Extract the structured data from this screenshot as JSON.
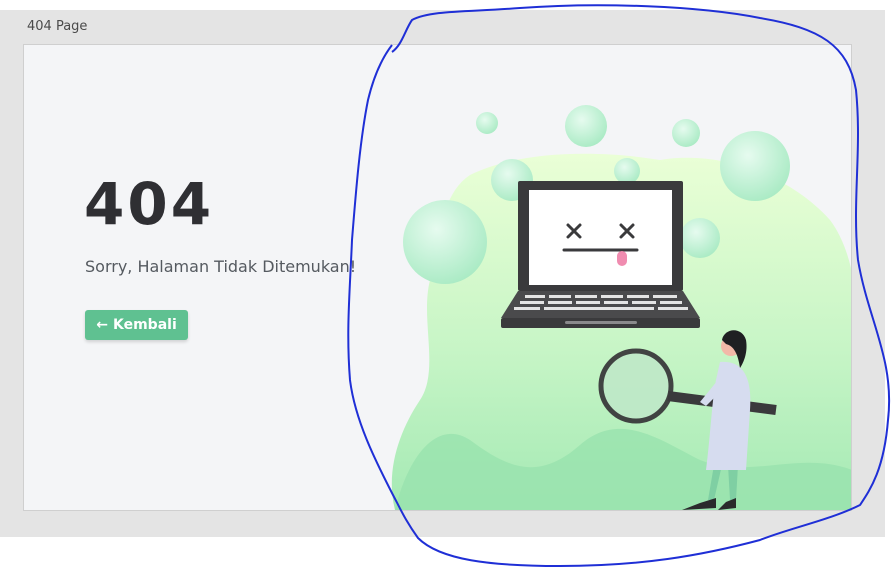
{
  "window": {
    "title": "404 Page"
  },
  "error": {
    "code": "404",
    "message": "Sorry, Halaman Tidak Ditemukan!"
  },
  "back_button": {
    "icon": "arrow-left-icon",
    "label": "Kembali"
  },
  "colors": {
    "accent": "#5fc191",
    "frame_bg": "#e4e4e4",
    "card_bg": "#f4f5f7",
    "title_text": "#2f2f33",
    "annotation_stroke": "#1f2fd6"
  },
  "illustration": {
    "subject": "broken-laptop-with-person-holding-magnifying-glass",
    "screen_icon": "dizzy-face-icon"
  }
}
